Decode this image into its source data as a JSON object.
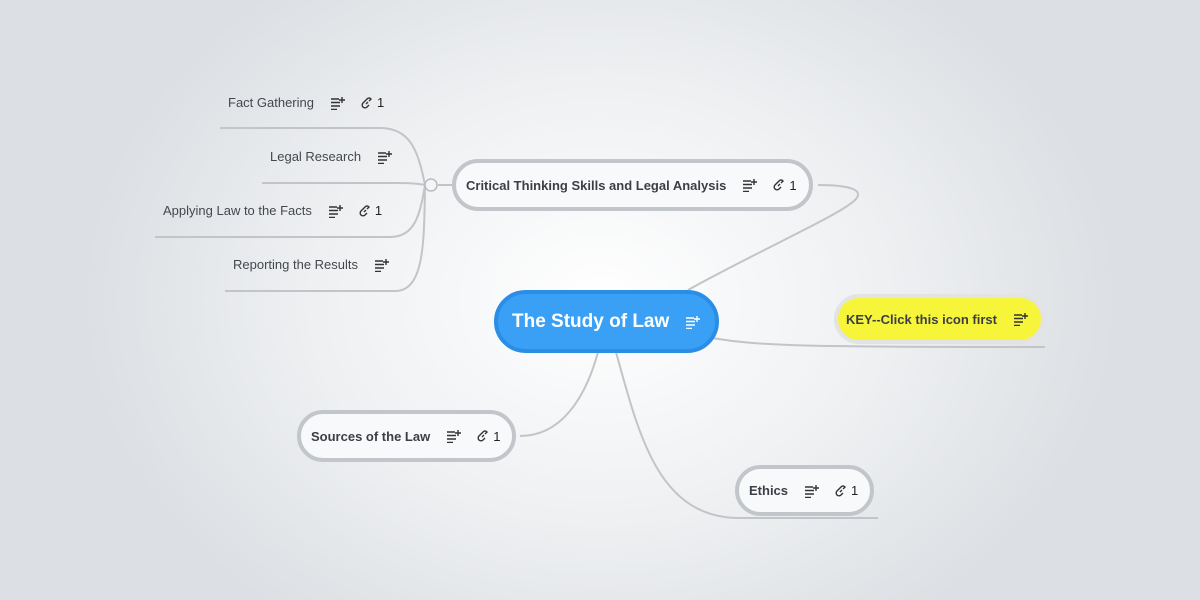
{
  "root": {
    "title": "The Study of Law",
    "icon": "notes-add-icon"
  },
  "critical": {
    "title": "Critical Thinking Skills and Legal Analysis",
    "link_count": "1",
    "children": [
      {
        "title": "Fact Gathering",
        "link_count": "1"
      },
      {
        "title": "Legal Research",
        "link_count": ""
      },
      {
        "title": "Applying Law to the Facts",
        "link_count": "1"
      },
      {
        "title": "Reporting the Results",
        "link_count": ""
      }
    ]
  },
  "key": {
    "title": "KEY--Click this icon first",
    "icon": "notes-add-icon"
  },
  "sources": {
    "title": "Sources of the Law",
    "link_count": "1"
  },
  "ethics": {
    "title": "Ethics",
    "link_count": "1"
  },
  "colors": {
    "root_fill": "#3aa0f5",
    "key_fill": "#f6f53a",
    "node_border": "#c2c5ca",
    "connector": "#c2c4c8"
  },
  "icons": [
    "notes-add-icon",
    "link-icon"
  ]
}
